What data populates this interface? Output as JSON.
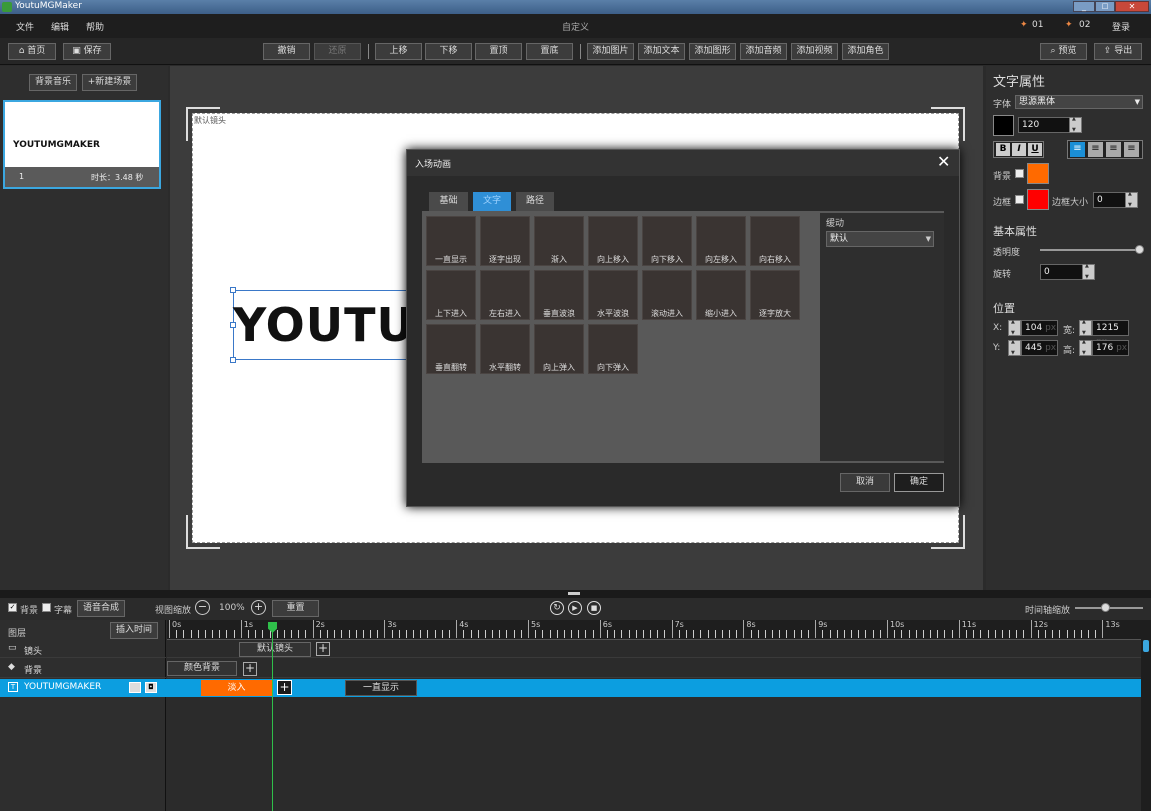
{
  "window": {
    "title": "YoutuMGMaker"
  },
  "menu": {
    "items": [
      "文件",
      "编辑",
      "帮助"
    ],
    "center_title": "自定义",
    "badge1": "01",
    "badge2": "02",
    "login": "登录"
  },
  "toolbar": {
    "home": "首页",
    "save": "保存",
    "undo": "撤销",
    "redo": "还原",
    "move_up": "上移",
    "move_down": "下移",
    "to_top": "置顶",
    "to_bottom": "置底",
    "add_image": "添加图片",
    "add_text": "添加文本",
    "add_shape": "添加图形",
    "add_audio": "添加音频",
    "add_video": "添加视频",
    "add_role": "添加角色",
    "preview": "预览",
    "export": "导出"
  },
  "left_panel": {
    "bg_music": "背景音乐",
    "new_scene": "+新建场景",
    "scene": {
      "title": "YOUTUMGMAKER",
      "index": "1",
      "duration": "时长：3.48 秒"
    }
  },
  "canvas": {
    "camera_label": "默认镜头",
    "big_text": "YOUTU"
  },
  "dialog": {
    "title": "入场动画",
    "tabs": [
      "基础",
      "文字",
      "路径"
    ],
    "active_tab": 1,
    "tiles": [
      "一直显示",
      "逐字出现",
      "渐入",
      "向上移入",
      "向下移入",
      "向左移入",
      "向右移入",
      "上下进入",
      "左右进入",
      "垂直波浪",
      "水平波浪",
      "滚动进入",
      "缩小进入",
      "逐字放大",
      "垂直翻转",
      "水平翻转",
      "向上弹入",
      "向下弹入"
    ],
    "easing_label": "缓动",
    "easing_value": "默认",
    "cancel": "取消",
    "ok": "确定"
  },
  "right_panel": {
    "title": "文字属性",
    "font_label": "字体",
    "font_value": "思源黑体",
    "font_size": "120",
    "bg_label": "背景",
    "border_label": "边框",
    "border_size_label": "边框大小",
    "border_size": "0",
    "bg_color": "#ff6a00",
    "border_color": "#ff0000",
    "text_color": "#000000",
    "basic_title": "基本属性",
    "opacity_label": "透明度",
    "opacity": 1.0,
    "rotate_label": "旋转",
    "rotate": "0",
    "pos_title": "位置",
    "x_label": "X:",
    "x": "104",
    "y_label": "Y:",
    "y": "445",
    "w_label": "宽:",
    "w": "1215",
    "h_label": "高:",
    "h": "176",
    "unit": "px"
  },
  "timeline": {
    "bg_check": "背景",
    "subtitle_check": "字幕",
    "tts": "语音合成",
    "zoom_label": "视图缩放",
    "zoom_value": "100%",
    "reset": "重置",
    "time_zoom_label": "时间轴缩放",
    "layer_header": "图层",
    "insert_time": "插入时间",
    "ruler": [
      "0s",
      "1s",
      "2s",
      "3s",
      "4s",
      "5s",
      "6s",
      "7s",
      "8s",
      "9s",
      "10s",
      "11s",
      "12s",
      "13s"
    ],
    "rows": [
      {
        "name": "镜头",
        "clips": [
          "默认镜头"
        ]
      },
      {
        "name": "背景",
        "clips": [
          "颜色背景"
        ]
      },
      {
        "name": "YOUTUMGMAKER",
        "clips": [
          "淡入",
          "一直显示"
        ]
      }
    ]
  }
}
